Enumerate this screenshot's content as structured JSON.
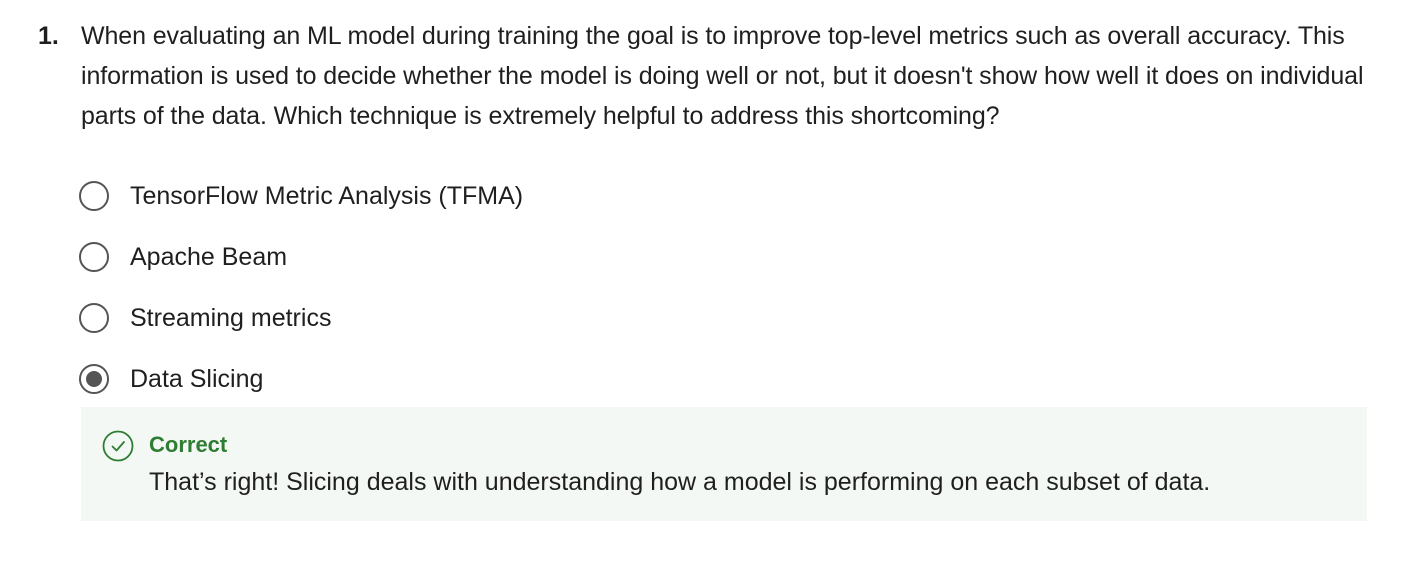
{
  "question": {
    "number": "1.",
    "text": "When evaluating an ML model during training the goal is to improve top-level metrics such as overall accuracy. This information is used to decide whether the model is doing well or not, but it doesn't show how well it does on individual parts of the data. Which technique is extremely helpful to address this shortcoming?"
  },
  "options": [
    {
      "label": "TensorFlow Metric Analysis (TFMA)",
      "selected": false
    },
    {
      "label": "Apache Beam",
      "selected": false
    },
    {
      "label": "Streaming metrics",
      "selected": false
    },
    {
      "label": "Data Slicing",
      "selected": true
    }
  ],
  "feedback": {
    "icon": "check-circle-icon",
    "title": "Correct",
    "text": "That’s right! Slicing deals with understanding how a model is performing on each subset of data.",
    "title_color": "#2e7d32",
    "background_color": "#f4f8f4"
  }
}
